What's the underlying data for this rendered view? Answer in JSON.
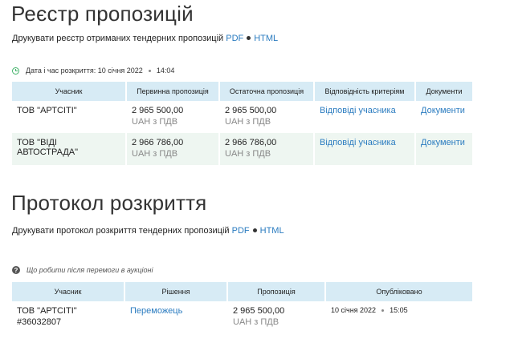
{
  "registry": {
    "title": "Реєстр пропозицій",
    "print_text": "Друкувати реєстр отриманих тендерних пропозицій",
    "print_pdf": "PDF",
    "print_html": "HTML",
    "date_label": "Дата і час розкриття: 10 січня 2022",
    "date_time": "14:04",
    "columns": [
      "Учасник",
      "Первинна пропозиція",
      "Остаточна пропозиція",
      "Відповідність критеріям",
      "Документи"
    ],
    "rows": [
      {
        "participant": "ТОВ \"АРТСІТІ\"",
        "initial": "2 965 500,00",
        "initial_note": "UAH з ПДВ",
        "final": "2 965 500,00",
        "final_note": "UAH з ПДВ",
        "criteria_link": "Відповіді учасника",
        "docs_link": "Документи"
      },
      {
        "participant": "ТОВ \"ВІДІ АВТОСТРАДА\"",
        "initial": "2 966 786,00",
        "initial_note": "UAH з ПДВ",
        "final": "2 966 786,00",
        "final_note": "UAH з ПДВ",
        "criteria_link": "Відповіді учасника",
        "docs_link": "Документи"
      }
    ]
  },
  "protocol": {
    "title": "Протокол розкриття",
    "print_text": "Друкувати протокол розкриття тендерних пропозицій",
    "print_pdf": "PDF",
    "print_html": "HTML",
    "help_text": "Що робити після перемоги в аукціоні",
    "columns": [
      "Учасник",
      "Рішення",
      "Пропозиція",
      "Опубліковано"
    ],
    "rows": [
      {
        "participant": "ТОВ \"АРТСІТІ\"",
        "participant_id": "#36032807",
        "decision_link": "Переможець",
        "offer": "2 965 500,00",
        "offer_note": "UAH з ПДВ",
        "published_date": "10 січня 2022",
        "published_time": "15:05"
      }
    ]
  },
  "colors": {
    "link": "#2b7cc0",
    "header_bg": "#d7ebf5",
    "alt_row_bg": "#eef6f1",
    "clock_icon": "#43b36a"
  }
}
